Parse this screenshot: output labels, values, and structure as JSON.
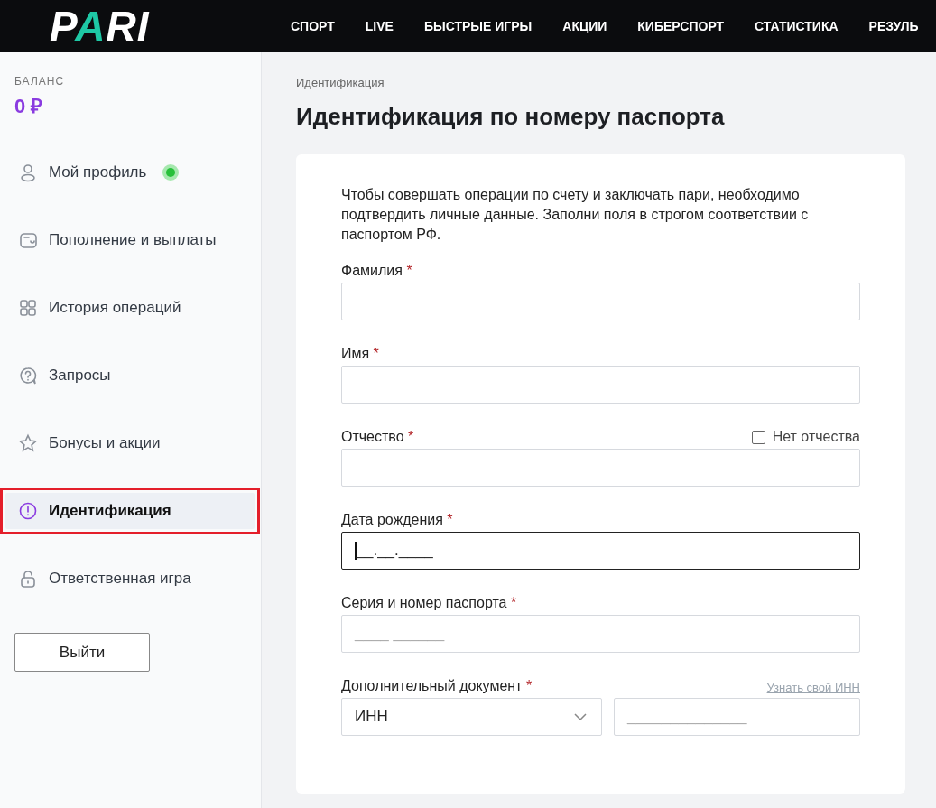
{
  "header": {
    "logo": "PARI",
    "nav": [
      "СПОРТ",
      "LIVE",
      "БЫСТРЫЕ ИГРЫ",
      "АКЦИИ",
      "КИБЕРСПОРТ",
      "СТАТИСТИКА",
      "РЕЗУЛЬ"
    ]
  },
  "sidebar": {
    "balance_label": "БАЛАНС",
    "balance": "0 ₽",
    "items": [
      {
        "label": "Мой профиль",
        "selected": false,
        "status_dot": true,
        "highlighted": false
      },
      {
        "label": "Пополнение и выплаты",
        "selected": false,
        "status_dot": false,
        "highlighted": false
      },
      {
        "label": "История операций",
        "selected": false,
        "status_dot": false,
        "highlighted": false
      },
      {
        "label": "Запросы",
        "selected": false,
        "status_dot": false,
        "highlighted": false
      },
      {
        "label": "Бонусы и акции",
        "selected": false,
        "status_dot": false,
        "highlighted": false
      },
      {
        "label": "Идентификация",
        "selected": true,
        "status_dot": false,
        "highlighted": true
      },
      {
        "label": "Ответственная игра",
        "selected": false,
        "status_dot": false,
        "highlighted": false
      }
    ],
    "logout": "Выйти"
  },
  "breadcrumb": "Идентификация",
  "title": "Идентификация по номеру паспорта",
  "form": {
    "intro": "Чтобы совершать операции по счету и заключать пари, необходимо подтвердить личные данные. Заполни поля в строгом соответствии с паспортом РФ.",
    "fields": [
      {
        "kind": "text",
        "label": "Фамилия",
        "required": "*",
        "focused": false
      },
      {
        "kind": "text",
        "label": "Имя",
        "required": "*",
        "focused": false
      },
      {
        "kind": "text",
        "label": "Отчество",
        "required": "*",
        "focused": false,
        "checkbox": {
          "label": "Нет отчества",
          "checked": false
        }
      },
      {
        "kind": "text",
        "label": "Дата рождения",
        "required": "*",
        "focused": true,
        "value": "__.__.____"
      },
      {
        "kind": "text",
        "label": "Серия и номер паспорта",
        "required": "*",
        "focused": false,
        "placeholder": "____ ______"
      },
      {
        "kind": "document",
        "label": "Дополнительный документ",
        "required": "*",
        "link": "Узнать свой ИНН",
        "select": "ИНН",
        "placeholder": "______________"
      }
    ]
  }
}
